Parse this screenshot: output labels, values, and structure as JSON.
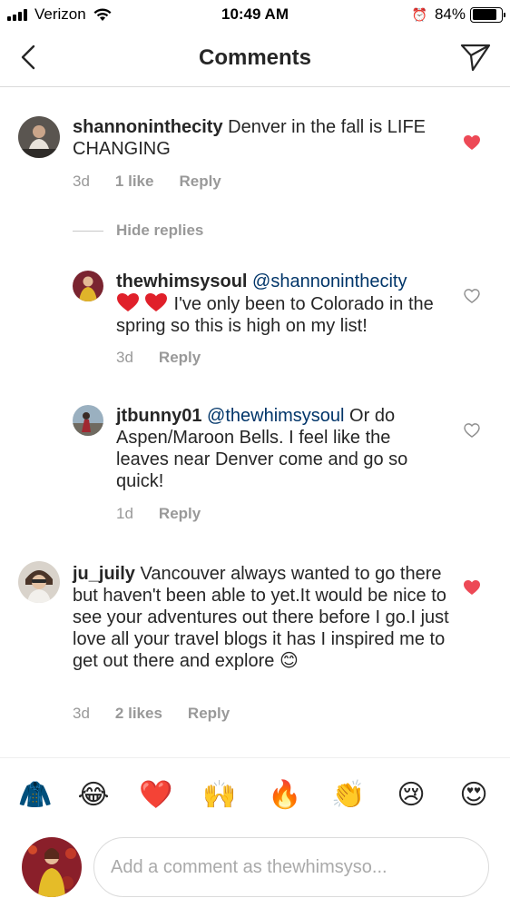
{
  "status_bar": {
    "carrier": "Verizon",
    "time": "10:49 AM",
    "battery_percent": "84%",
    "battery_level": 0.84
  },
  "header": {
    "title": "Comments",
    "back_icon": "chevron-left-icon",
    "send_icon": "paper-plane-icon"
  },
  "comments": [
    {
      "username": "shannoninthecity",
      "text": " Denver in the fall is LIFE CHANGING",
      "age": "3d",
      "likes": "1 like",
      "reply_label": "Reply",
      "liked": true
    }
  ],
  "hide_replies_label": "Hide replies",
  "replies": [
    {
      "username": "thewhimsysoul",
      "mention": "@shannoninthecity",
      "text": " I've only been to Colorado in the spring so this is high on my list!",
      "inline_emoji": "two-red-hearts",
      "age": "3d",
      "reply_label": "Reply",
      "liked": false
    },
    {
      "username": "jtbunny01",
      "mention": "@thewhimsysoul",
      "text": " Or do Aspen/Maroon Bells. I feel like the leaves near Denver come and go so quick!",
      "age": "1d",
      "reply_label": "Reply",
      "liked": false
    }
  ],
  "comment2": {
    "username": "ju_juily",
    "text": " Vancouver always wanted to go there but haven't been able to yet.It would be nice to see your adventures out there before I go.I just love all your travel blogs it has I inspired me to get  out there and explore ",
    "trailing_emoji": "😊",
    "age": "3d",
    "likes": "2 likes",
    "reply_label": "Reply",
    "liked": true
  },
  "emoji_bar": [
    "🧥",
    "😂",
    "❤️",
    "🙌",
    "🔥",
    "👏",
    "😢",
    "😍"
  ],
  "composer": {
    "placeholder": "Add a comment as thewhimsyso..."
  },
  "colors": {
    "like_red": "#ed4956",
    "mention_blue": "#003569",
    "meta_gray": "#999999"
  }
}
